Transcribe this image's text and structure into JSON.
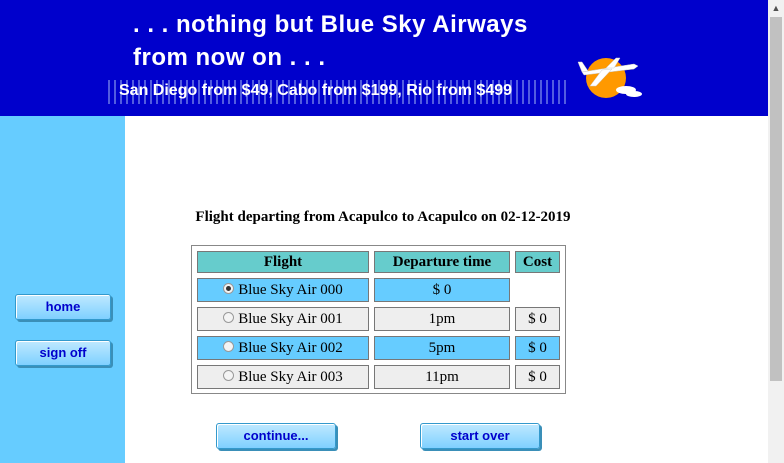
{
  "banner": {
    "tagline_line1": ". . . nothing but Blue Sky Airways",
    "tagline_line2": "from now on . . .",
    "promo": "San Diego from $49, Cabo from $199, Rio from $499",
    "logo_icon": "airplane-sun-logo",
    "background_color": "#0000cc"
  },
  "sidebar": {
    "home_label": "home",
    "signoff_label": "sign off",
    "background_color": "#66ccff"
  },
  "main": {
    "heading": "Flight departing from Acapulco to Acapulco on 02-12-2019",
    "table": {
      "headers": {
        "flight": "Flight",
        "departure": "Departure time",
        "cost": "Cost"
      },
      "rows": [
        {
          "flight": "Blue Sky Air 000",
          "departure": "$ 0",
          "cost": "",
          "selected": true
        },
        {
          "flight": "Blue Sky Air 001",
          "departure": "1pm",
          "cost": "$ 0",
          "selected": false
        },
        {
          "flight": "Blue Sky Air 002",
          "departure": "5pm",
          "cost": "$ 0",
          "selected": false
        },
        {
          "flight": "Blue Sky Air 003",
          "departure": "11pm",
          "cost": "$ 0",
          "selected": false
        }
      ]
    },
    "continue_label": "continue...",
    "startover_label": "start over"
  }
}
